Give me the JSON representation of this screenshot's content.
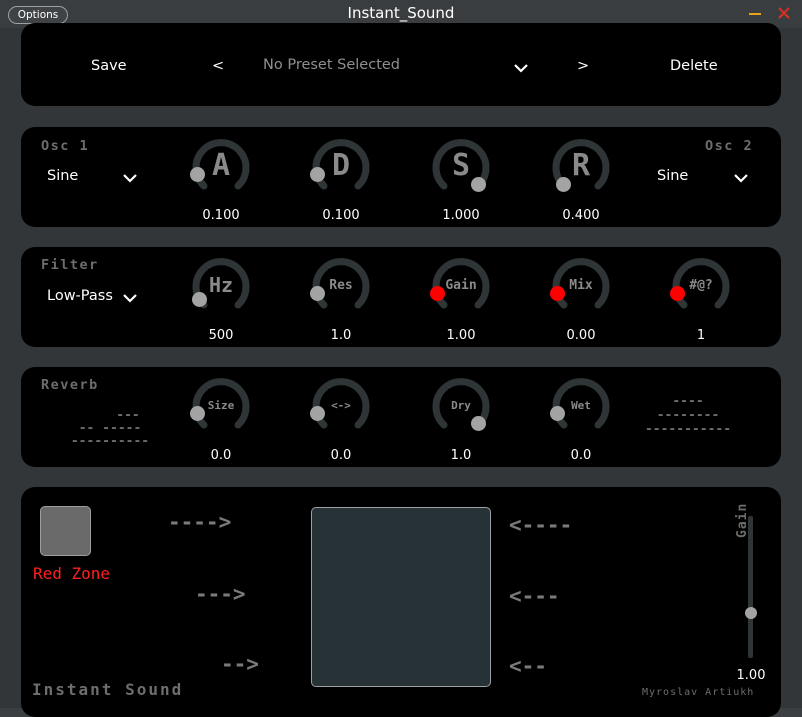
{
  "window": {
    "title": "Instant_Sound",
    "options_label": "Options"
  },
  "preset": {
    "save_label": "Save",
    "prev_label": "<",
    "selected": "No Preset Selected",
    "next_label": ">",
    "delete_label": "Delete"
  },
  "osc": {
    "osc1_title": "Osc 1",
    "osc1_wave": "Sine",
    "osc2_title": "Osc 2",
    "osc2_wave": "Sine",
    "knobs": [
      {
        "label": "A",
        "value": "0.100",
        "level": 0.1
      },
      {
        "label": "D",
        "value": "0.100",
        "level": 0.1
      },
      {
        "label": "S",
        "value": "1.000",
        "level": 1.0
      },
      {
        "label": "R",
        "value": "0.400",
        "level": 0.0
      }
    ]
  },
  "filter": {
    "title": "Filter",
    "type": "Low-Pass",
    "knobs": [
      {
        "label": "Hz",
        "value": "500",
        "level": 0.05
      },
      {
        "label": "Res",
        "value": "1.0",
        "level": 0.1
      },
      {
        "label": "Gain",
        "value": "1.00",
        "level": 0.1
      },
      {
        "label": "Mix",
        "value": "0.00",
        "level": 0.1
      },
      {
        "label": "#@?",
        "value": "1",
        "level": 0.1
      }
    ]
  },
  "reverb": {
    "title": "Reverb",
    "left_dashes": [
      "---",
      "-- -----",
      "----------"
    ],
    "right_dashes": [
      "----",
      "--------",
      "-----------"
    ],
    "knobs": [
      {
        "label": "Size",
        "value": "0.0",
        "level": 0.1
      },
      {
        "label": "<->",
        "value": "0.0",
        "level": 0.1
      },
      {
        "label": "Dry",
        "value": "1.0",
        "level": 1.0
      },
      {
        "label": "Wet",
        "value": "0.0",
        "level": 0.1
      }
    ]
  },
  "red_zone": {
    "label": "Red Zone",
    "arrows_left": [
      "---->",
      "--->",
      "-->"
    ],
    "arrows_right": [
      "<----",
      "<---",
      "<--"
    ],
    "footer_title": "Instant Sound",
    "author": "Myroslav Artiukh",
    "gain_label": "Gain",
    "gain_value": "1.00",
    "gain_level": 0.5
  },
  "colors": {
    "active_dot": "#ff0000",
    "knob_dot": "#a3a3a3",
    "red_zone_text": "#ff2020"
  },
  "icons": {
    "chevron": "chevron-down-icon",
    "minimize": "minimize-icon",
    "close": "close-icon"
  }
}
